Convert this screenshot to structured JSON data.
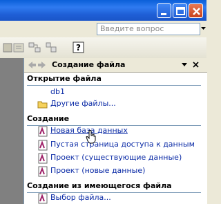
{
  "window": {
    "title_buttons": [
      "minimize",
      "maximize",
      "close"
    ]
  },
  "menubar": {
    "ask_placeholder": "Введите вопрос"
  },
  "task_pane": {
    "title": "Создание файла",
    "sections": {
      "open": {
        "heading": "Открытие файла",
        "recent": "db1",
        "more": "Другие файлы..."
      },
      "new": {
        "heading": "Создание",
        "items": [
          "Новая база данных",
          "Пустая страница доступа к данным",
          "Проект (существующие данные)",
          "Проект (новые данные)"
        ]
      },
      "from_existing": {
        "heading": "Создание из имеющегося файла",
        "items": [
          "Выбор файла..."
        ]
      }
    }
  },
  "colors": {
    "title_blue": "#2f7bf0",
    "link": "#0a2aa6",
    "close_red": "#c8401a"
  }
}
